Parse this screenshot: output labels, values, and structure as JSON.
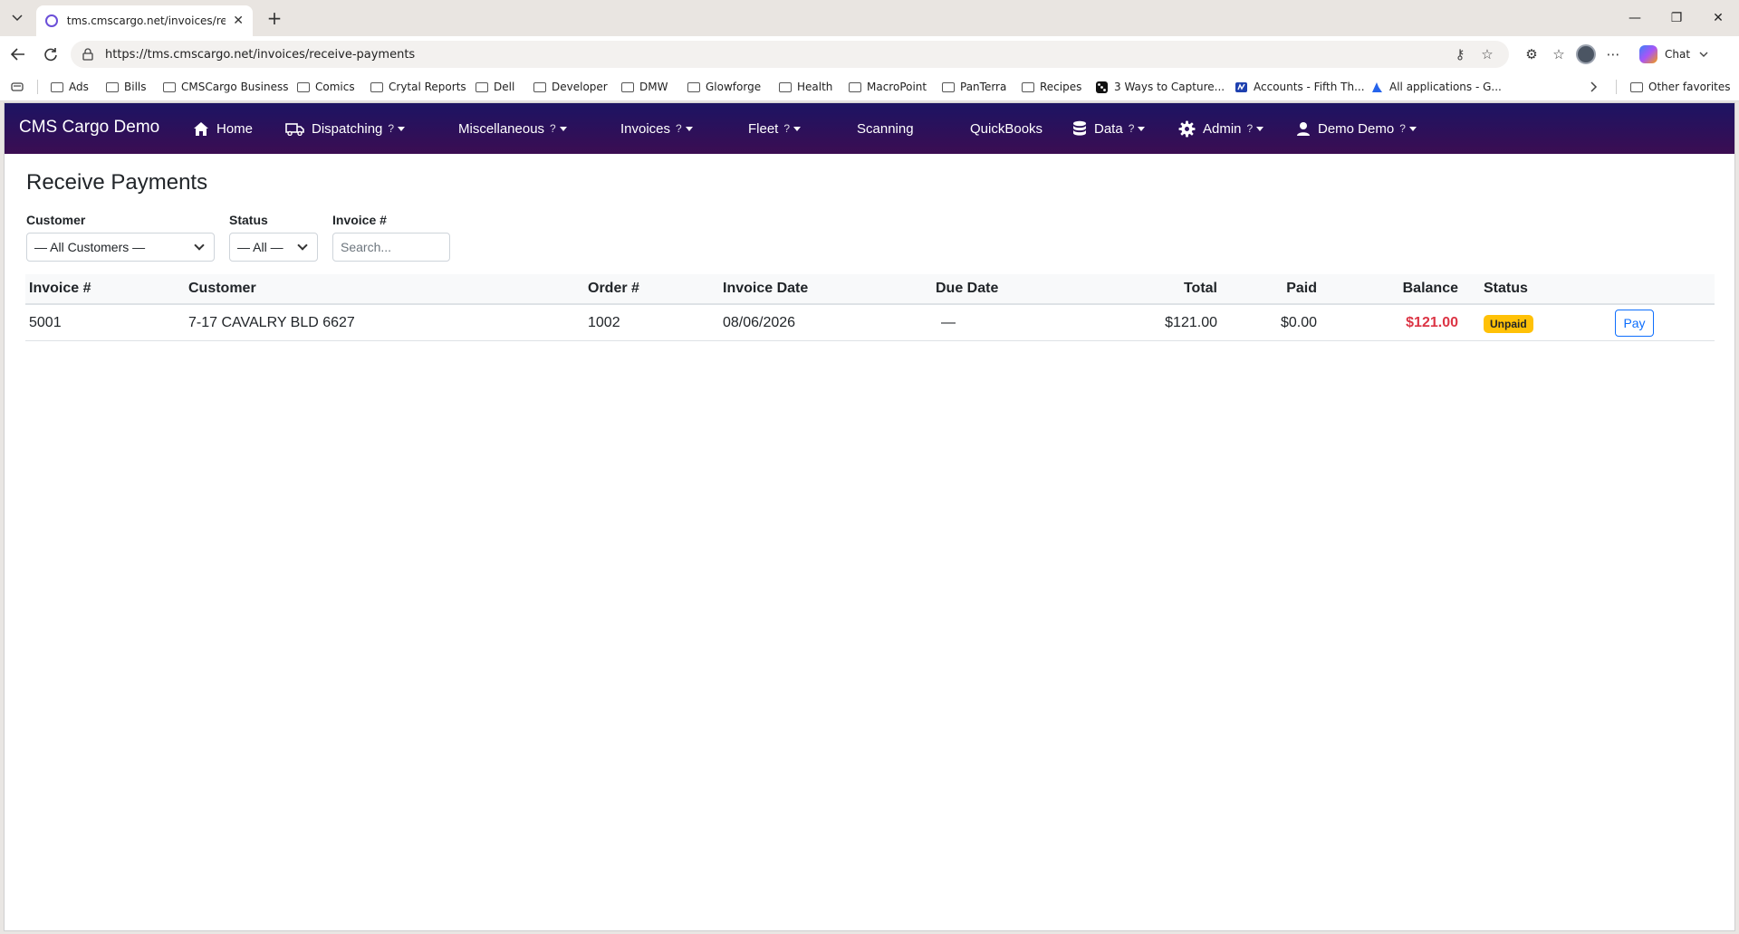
{
  "browser": {
    "tab_title": "tms.cmscargo.net/invoices/receive-payments",
    "url": "https://tms.cmscargo.net/invoices/receive-payments",
    "copilot_label": "Chat",
    "bookmarks": [
      "Ads",
      "Bills",
      "CMSCargo Business",
      "Comics",
      "Crytal Reports",
      "Dell",
      "Developer",
      "DMW",
      "Glowforge",
      "Health",
      "MacroPoint",
      "PanTerra",
      "Recipes",
      "3 Ways to Capture...",
      "Accounts - Fifth Th...",
      "All applications - G..."
    ],
    "other_favorites": "Other favorites"
  },
  "nav": {
    "brand": "CMS Cargo Demo",
    "items": {
      "home": "Home",
      "dispatching": "Dispatching",
      "miscellaneous": "Miscellaneous",
      "invoices": "Invoices",
      "fleet": "Fleet",
      "scanning": "Scanning",
      "quickbooks": "QuickBooks",
      "data": "Data",
      "admin": "Admin",
      "user": "Demo Demo"
    },
    "help_mark": "?"
  },
  "page": {
    "title": "Receive Payments",
    "filters": {
      "customer_label": "Customer",
      "customer_value": "— All Customers —",
      "status_label": "Status",
      "status_value": "— All —",
      "invoice_label": "Invoice #",
      "invoice_placeholder": "Search..."
    },
    "table": {
      "headers": {
        "invoice": "Invoice #",
        "customer": "Customer",
        "order": "Order #",
        "invoice_date": "Invoice Date",
        "due_date": "Due Date",
        "total": "Total",
        "paid": "Paid",
        "balance": "Balance",
        "status": "Status"
      },
      "rows": [
        {
          "invoice": "5001",
          "customer": "7-17 CAVALRY BLD 6627",
          "order": "1002",
          "invoice_date": "08/06/2026",
          "due_date": "—",
          "total": "$121.00",
          "paid": "$0.00",
          "balance": "$121.00",
          "status": "Unpaid",
          "action": "Pay"
        }
      ]
    }
  },
  "colors": {
    "nav_start": "#1c1463",
    "nav_end": "#3b0d52",
    "balance_due": "#dc3545",
    "unpaid_badge": "#ffc107",
    "primary": "#0d6efd"
  }
}
